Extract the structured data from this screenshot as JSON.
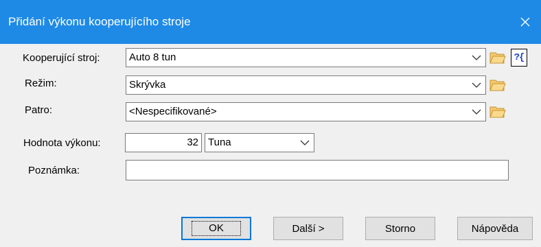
{
  "window": {
    "title": "Přidání výkonu kooperujícího stroje"
  },
  "form": {
    "machine": {
      "label": "Kooperující stroj:",
      "value": "Auto 8 tun",
      "help_text": "?{"
    },
    "mode": {
      "label": "Režim:",
      "value": "Skrývka"
    },
    "floor": {
      "label": "Patro:",
      "value": "<Nespecifikované>"
    },
    "performance": {
      "label": "Hodnota výkonu:",
      "value": "32",
      "unit": "Tuna"
    },
    "note": {
      "label": "Poznámka:",
      "value": ""
    }
  },
  "buttons": {
    "ok": "OK",
    "next": "Další >",
    "cancel": "Storno",
    "help": "Nápověda"
  },
  "colors": {
    "titlebar": "#1e8ae6",
    "folder_fill": "#f5c871",
    "folder_stroke": "#c4932f",
    "focus_border": "#0078d7"
  }
}
